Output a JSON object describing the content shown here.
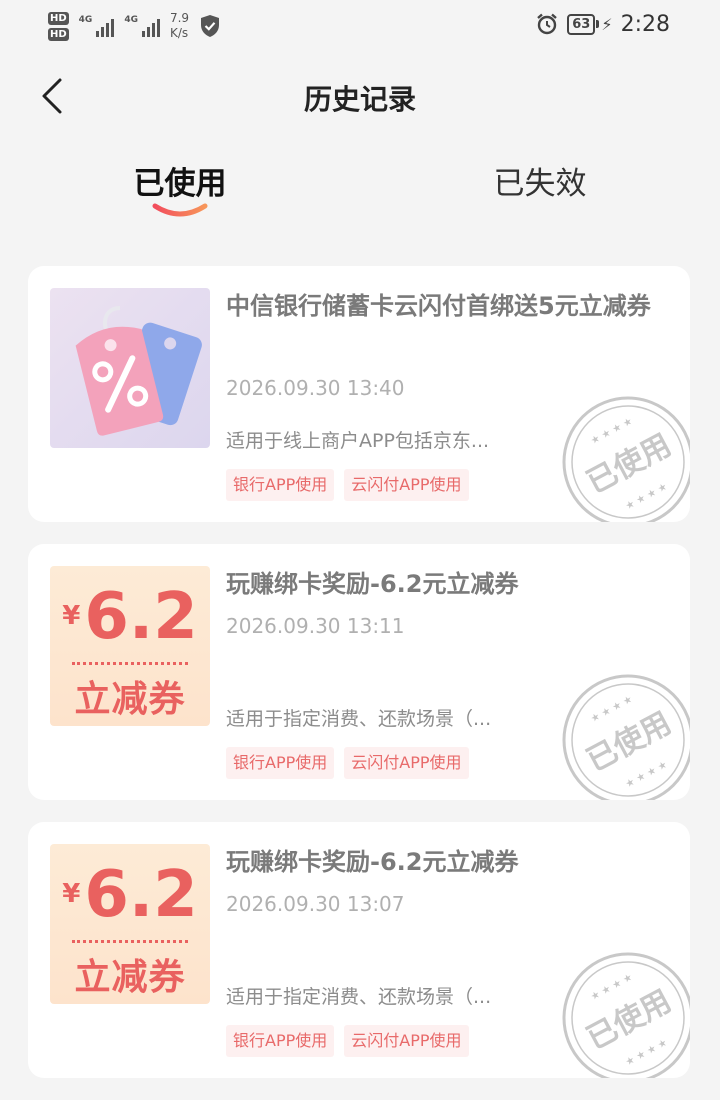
{
  "status_bar": {
    "hd1": "HD",
    "hd2": "HD",
    "net1": "4G",
    "net2": "4G",
    "speed_value": "7.9",
    "speed_unit": "K/s",
    "battery": "63",
    "time": "2:28"
  },
  "header": {
    "title": "历史记录"
  },
  "tabs": [
    {
      "label": "已使用",
      "active": true
    },
    {
      "label": "已失效",
      "active": false
    }
  ],
  "coupons": [
    {
      "title": "中信银行储蓄卡云闪付首绑送5元立减券",
      "time": "2026.09.30 13:40",
      "desc": "适用于线上商户APP包括京东...",
      "tags": [
        "银行APP使用",
        "云闪付APP使用"
      ],
      "stamp": "已使用"
    },
    {
      "title": "玩赚绑卡奖励-6.2元立减券",
      "time": "2026.09.30 13:11",
      "desc": "适用于指定消费、还款场景（...",
      "tags": [
        "银行APP使用",
        "云闪付APP使用"
      ],
      "thumb_currency": "¥",
      "thumb_amount": "6.2",
      "thumb_label": "立减券",
      "stamp": "已使用"
    },
    {
      "title": "玩赚绑卡奖励-6.2元立减券",
      "time": "2026.09.30 13:07",
      "desc": "适用于指定消费、还款场景（...",
      "tags": [
        "银行APP使用",
        "云闪付APP使用"
      ],
      "thumb_currency": "¥",
      "thumb_amount": "6.2",
      "thumb_label": "立减券",
      "stamp": "已使用"
    }
  ],
  "colors": {
    "accent": "#e9615f",
    "tab_indicator_start": "#f24d5c",
    "tab_indicator_end": "#f7965a",
    "tag_bg": "#fdf0f0",
    "tag_text": "#e86a6a",
    "stamp": "#c8c8c8"
  }
}
